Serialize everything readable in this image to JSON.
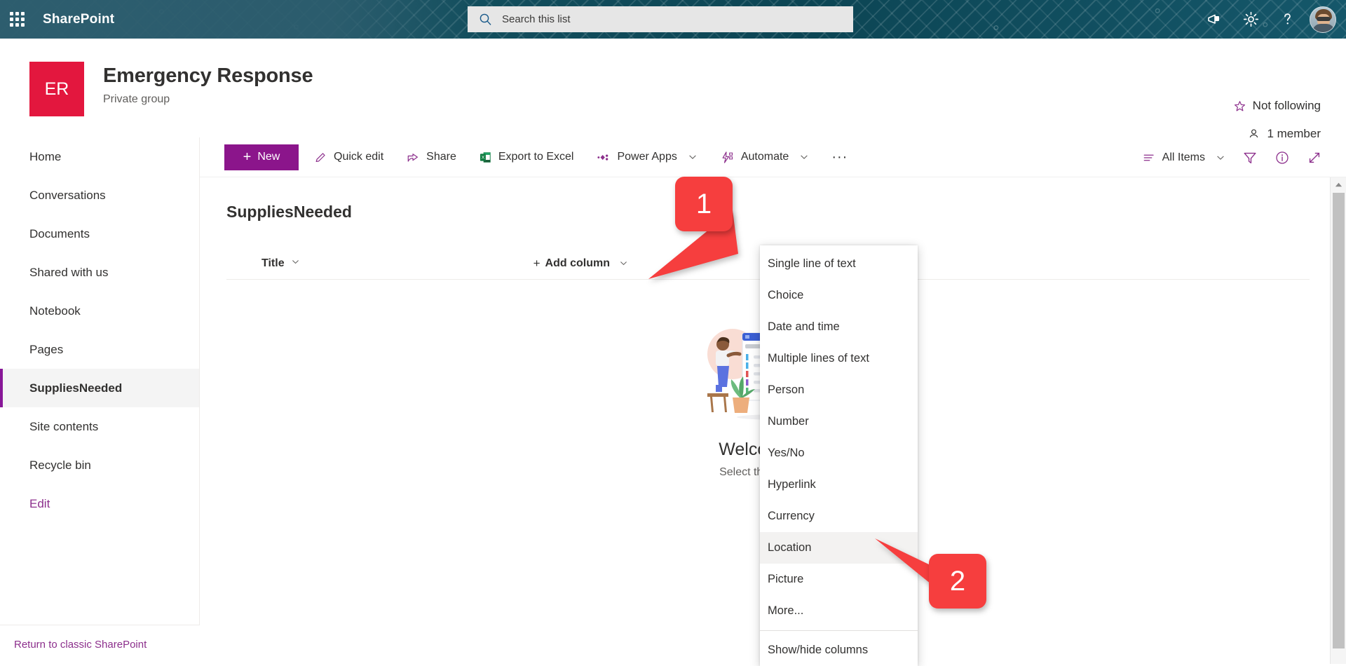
{
  "suite": {
    "brand": "SharePoint",
    "waffle_label": "app-launcher",
    "search_placeholder": "Search this list",
    "search_value": "",
    "icons": [
      "megaphone-icon",
      "gear-icon",
      "help-icon",
      "avatar"
    ]
  },
  "site": {
    "logo_initials": "ER",
    "title": "Emergency Response",
    "subtitle": "Private group",
    "follow_label": "Not following",
    "member_label": "1 member",
    "logo_color": "#e3173e"
  },
  "sidebar": {
    "items": [
      {
        "label": "Home",
        "selected": false
      },
      {
        "label": "Conversations",
        "selected": false
      },
      {
        "label": "Documents",
        "selected": false
      },
      {
        "label": "Shared with us",
        "selected": false
      },
      {
        "label": "Notebook",
        "selected": false
      },
      {
        "label": "Pages",
        "selected": false
      },
      {
        "label": "SuppliesNeeded",
        "selected": true
      },
      {
        "label": "Site contents",
        "selected": false
      },
      {
        "label": "Recycle bin",
        "selected": false
      },
      {
        "label": "Edit",
        "selected": false
      }
    ],
    "classic_link": "Return to classic SharePoint"
  },
  "command_bar": {
    "new_label": "New",
    "items": [
      {
        "label": "Quick edit",
        "icon": "pencil-icon",
        "chevron": false
      },
      {
        "label": "Share",
        "icon": "share-icon",
        "chevron": false
      },
      {
        "label": "Export to Excel",
        "icon": "excel-icon",
        "chevron": false
      },
      {
        "label": "Power Apps",
        "icon": "power-apps-icon",
        "chevron": true
      },
      {
        "label": "Automate",
        "icon": "automate-icon",
        "chevron": true
      }
    ],
    "overflow_label": "···",
    "view_label": "All Items",
    "right_icons": [
      "filter-icon",
      "info-icon",
      "expand-icon"
    ]
  },
  "list": {
    "title": "SuppliesNeeded",
    "column_header": "Title",
    "add_column_label": "Add column",
    "add_column_plus": "+",
    "empty_title": "Welcome to",
    "empty_subtitle": "Select the New bu"
  },
  "context_menu": {
    "items": [
      {
        "label": "Single line of text",
        "hovered": false
      },
      {
        "label": "Choice",
        "hovered": false
      },
      {
        "label": "Date and time",
        "hovered": false
      },
      {
        "label": "Multiple lines of text",
        "hovered": false
      },
      {
        "label": "Person",
        "hovered": false
      },
      {
        "label": "Number",
        "hovered": false
      },
      {
        "label": "Yes/No",
        "hovered": false
      },
      {
        "label": "Hyperlink",
        "hovered": false
      },
      {
        "label": "Currency",
        "hovered": false
      },
      {
        "label": "Location",
        "hovered": true
      },
      {
        "label": "Picture",
        "hovered": false
      },
      {
        "label": "More...",
        "hovered": false
      }
    ],
    "footer_item": "Show/hide columns"
  },
  "callouts": [
    {
      "number": "1",
      "color": "#f63e3e"
    },
    {
      "number": "2",
      "color": "#f63e3e"
    }
  ]
}
